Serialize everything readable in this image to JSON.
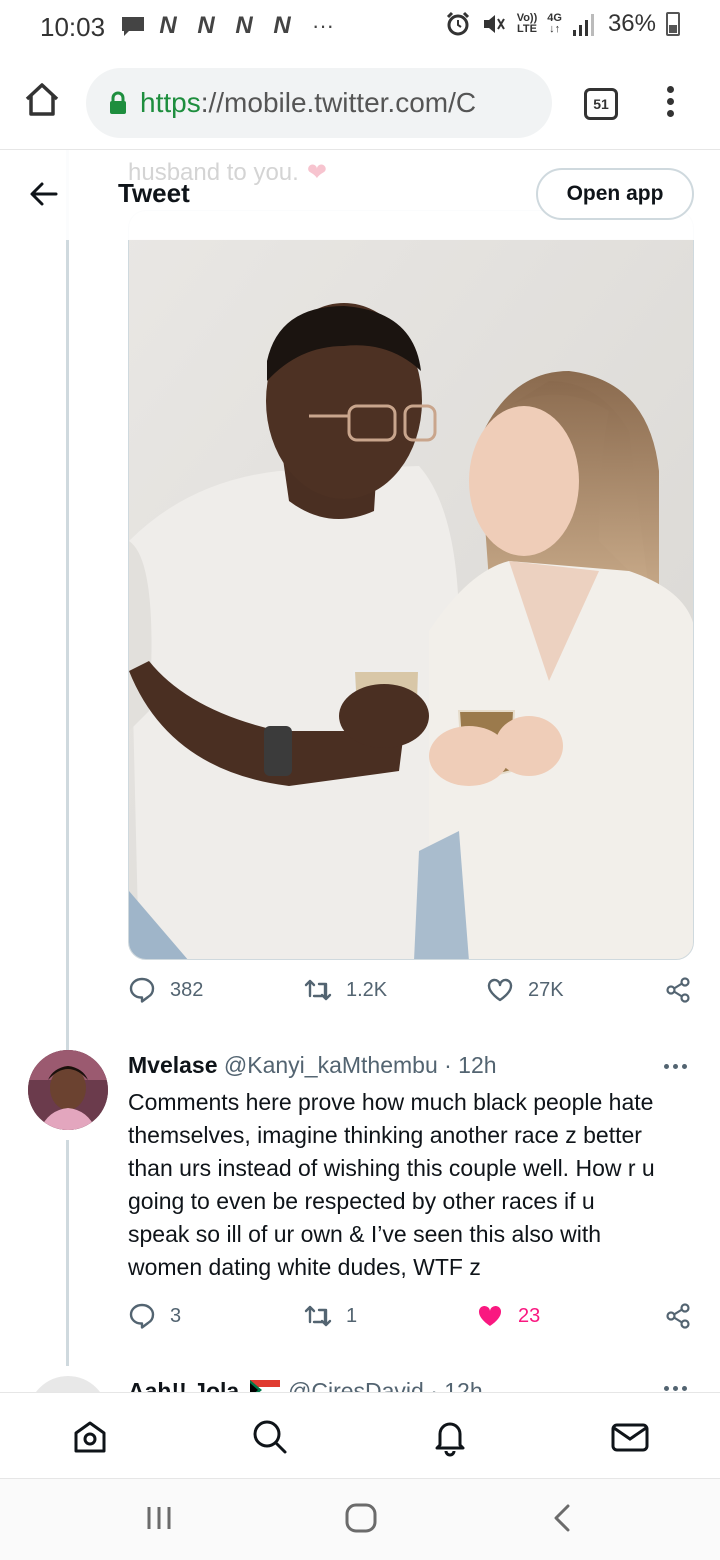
{
  "status_bar": {
    "time": "10:03",
    "notification_letters": [
      "N",
      "N",
      "N",
      "N"
    ],
    "more": "···",
    "volte_top": "Vo))",
    "volte_bottom": "LTE",
    "network": "4G",
    "battery": "36%"
  },
  "browser": {
    "url_scheme": "https",
    "url_rest": "://mobile.twitter.com/C",
    "tab_count": "51"
  },
  "header": {
    "title": "Tweet",
    "open_app": "Open app",
    "ghost_text": "husband to you."
  },
  "tweet": {
    "photo_description": "couple holding mugs",
    "stats": {
      "replies": "382",
      "retweets": "1.2K",
      "likes": "27K"
    }
  },
  "reply": {
    "name": "Mvelase",
    "handle_time": "@Kanyi_kaMthembu · 12h",
    "lines": [
      "Comments here prove how much black people hate",
      "themselves, imagine thinking another race z better",
      "than urs instead of wishing this couple well. How r u",
      "going to even be respected by other races if u",
      "speak so ill of ur own & I’ve seen this also with",
      "women dating white dudes, WTF z"
    ],
    "stats": {
      "replies": "3",
      "retweets": "1",
      "likes": "23"
    },
    "liked_color": "#f91880"
  },
  "next_tweet": {
    "name": "Aah!! Jola",
    "handle_time": "@CiresDavid · 12h"
  },
  "colors": {
    "secondary_text": "#536471",
    "url_green": "#1e8e3e",
    "like_pink": "#f91880"
  }
}
